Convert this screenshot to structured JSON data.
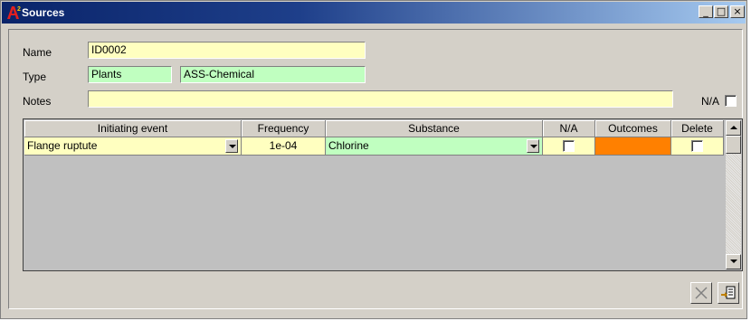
{
  "window": {
    "title": "Sources",
    "controls": {
      "minimize": "_",
      "maximize": "□",
      "close": "×"
    }
  },
  "form": {
    "name_label": "Name",
    "name_value": "ID0002",
    "type_label": "Type",
    "type_value": "Plants",
    "type_sub_value": "ASS-Chemical",
    "notes_label": "Notes",
    "notes_value": "",
    "na_label": "N/A",
    "na_checked": false
  },
  "grid": {
    "columns": [
      "Initiating event",
      "Frequency",
      "Substance",
      "N/A",
      "Outcomes",
      "Delete"
    ],
    "rows": [
      {
        "initiating_event": "Flange ruptute",
        "frequency": "1e-04",
        "substance": "Chlorine",
        "na": false,
        "outcomes_color": "#ff8000",
        "delete": false
      }
    ]
  },
  "colors": {
    "field_yellow": "#ffffc0",
    "field_green": "#c0ffc0",
    "outcomes_orange": "#ff8000",
    "titlebar_start": "#0a246a"
  },
  "icons": {
    "app": "app-logo-icon",
    "delete_button": "x-icon",
    "export_button": "export-icon"
  }
}
